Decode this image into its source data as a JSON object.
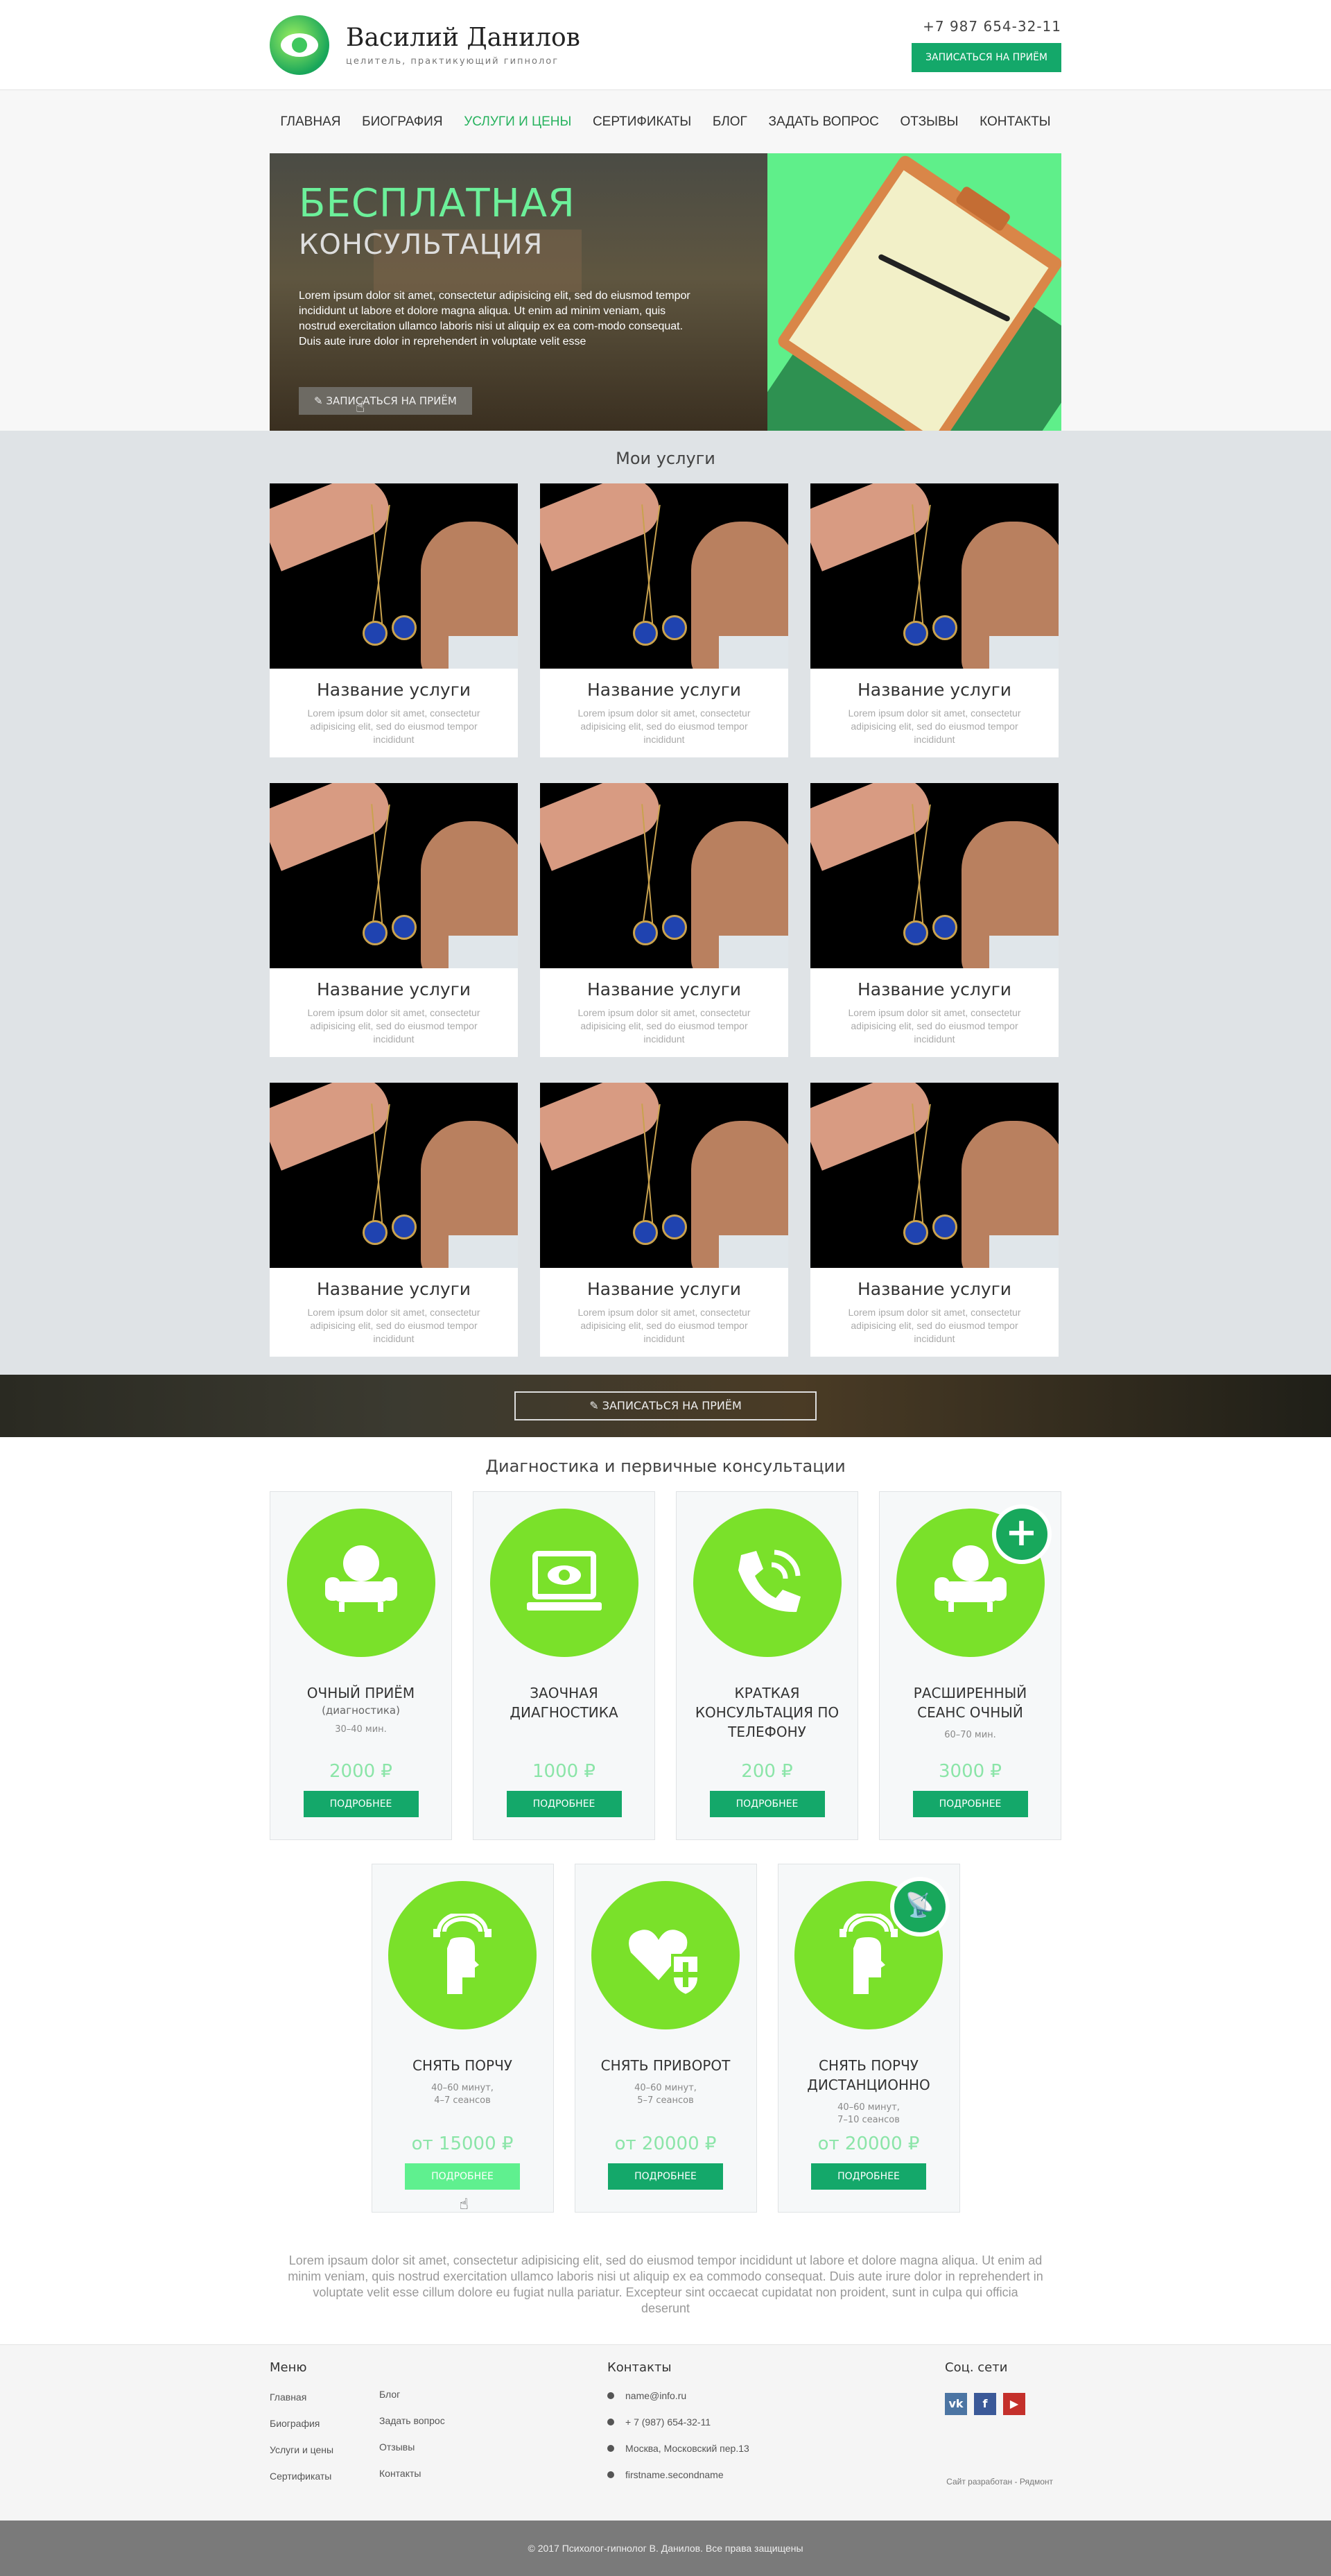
{
  "header": {
    "name": "Василий Данилов",
    "tagline": "целитель, практикующий гипнолог",
    "phone": "+7 987 654-32-11",
    "cta": "Записаться на приём"
  },
  "nav": [
    "Главная",
    "Биография",
    "Услуги и цены",
    "Сертификаты",
    "Блог",
    "Задать вопрос",
    "Отзывы",
    "Контакты"
  ],
  "nav_active": "Услуги и цены",
  "hero": {
    "title1": "БЕСПЛАТНАЯ",
    "title2": "КОНСУЛЬТАЦИЯ",
    "text": "Lorem ipsum dolor sit amet, consectetur adipisicing elit, sed do eiusmod tempor incididunt ut labore et dolore magna aliqua. Ut enim ad minim veniam, quis nostrud exercitation ullamco laboris nisi ut aliquip ex ea com-modo consequat. Duis aute irure dolor in reprehendert in voluptate velit esse",
    "button": "Записаться на приём"
  },
  "services": {
    "title": "Мои услуги",
    "items": [
      {
        "name": "Название услуги",
        "desc": "Lorem ipsum dolor sit amet, consectetur adipisicing elit, sed do eiusmod tempor incididunt"
      },
      {
        "name": "Название услуги",
        "desc": "Lorem ipsum dolor sit amet, consectetur adipisicing elit, sed do eiusmod tempor incididunt"
      },
      {
        "name": "Название услуги",
        "desc": "Lorem ipsum dolor sit amet, consectetur adipisicing elit, sed do eiusmod tempor incididunt"
      },
      {
        "name": "Название услуги",
        "desc": "Lorem ipsum dolor sit amet, consectetur adipisicing elit, sed do eiusmod tempor incididunt"
      },
      {
        "name": "Название услуги",
        "desc": "Lorem ipsum dolor sit amet, consectetur adipisicing elit, sed do eiusmod tempor incididunt"
      },
      {
        "name": "Название услуги",
        "desc": "Lorem ipsum dolor sit amet, consectetur adipisicing elit, sed do eiusmod tempor incididunt"
      },
      {
        "name": "Название услуги",
        "desc": "Lorem ipsum dolor sit amet, consectetur adipisicing elit, sed do eiusmod tempor incididunt"
      },
      {
        "name": "Название услуги",
        "desc": "Lorem ipsum dolor sit amet, consectetur adipisicing elit, sed do eiusmod tempor incididunt"
      },
      {
        "name": "Название услуги",
        "desc": "Lorem ipsum dolor sit amet, consectetur adipisicing elit, sed do eiusmod tempor incididunt"
      }
    ]
  },
  "cta_band": {
    "button": "Записаться на приём"
  },
  "diagnostics": {
    "title": "Диагностика и первичные консультации",
    "row1": [
      {
        "title": "Очный приём",
        "sub": "(диагностика)",
        "time": "30–40 мин.",
        "price": "2000 ₽",
        "button": "Подробнее",
        "icon": "armchair-icon"
      },
      {
        "title": "Заочная диагностика",
        "sub": "",
        "time": "",
        "price": "1000 ₽",
        "button": "Подробнее",
        "icon": "laptop-eye-icon"
      },
      {
        "title": "Краткая консультация по телефону",
        "sub": "",
        "time": "",
        "price": "200 ₽",
        "button": "Подробнее",
        "icon": "phone-icon"
      },
      {
        "title": "Расширенный сеанс очный",
        "sub": "",
        "time": "60–70 мин.",
        "price": "3000 ₽",
        "button": "Подробнее",
        "icon": "armchair-plus-icon",
        "badge": "+"
      }
    ],
    "row2": [
      {
        "title": "Снять порчу",
        "time": "40–60 минут,",
        "time2": "4–7 сеансов",
        "price": "от 15000 ₽",
        "button": "Подробнее",
        "icon": "head-rainbow-icon"
      },
      {
        "title": "Снять приворот",
        "time": "40–60 минут,",
        "time2": "5–7 сеансов",
        "price": "от 20000 ₽",
        "button": "Подробнее",
        "icon": "heart-shield-icon"
      },
      {
        "title": "Снять порчу дистанционно",
        "time": "40–60 минут,",
        "time2": "7–10 сеансов",
        "price": "от 20000 ₽",
        "button": "Подробнее",
        "icon": "head-satellite-icon"
      }
    ]
  },
  "lorem": "Lorem ipsaum dolor sit amet, consectetur adipisicing elit, sed do eiusmod tempor incididunt ut labore et dolore magna aliqua. Ut enim ad minim veniam, quis nostrud exercitation ullamco laboris nisi ut aliquip ex ea commodo consequat. Duis aute irure dolor in reprehendert in voluptate velit esse cillum dolore eu fugiat nulla pariatur. Excepteur sint occaecat cupidatat non proident, sunt in culpa qui officia deserunt",
  "footer": {
    "menu_title": "Меню",
    "menu_col1": [
      "Главная",
      "Биография",
      "Услуги и цены",
      "Сертификаты"
    ],
    "menu_col2": [
      "Блог",
      "Задать вопрос",
      "Отзывы",
      "Контакты"
    ],
    "contacts_title": "Контакты",
    "email": "name@info.ru",
    "phone": "+ 7 (987) 654-32-11",
    "address": "Москва, Московский  пер.13",
    "skype": "firstname.secondname",
    "social_title": "Соц. сети",
    "developer": "Сайт разработан - Рядмонт",
    "copyright": "© 2017 Психолог-гипнолог В. Данилов. Все права защищены"
  },
  "colors": {
    "accent": "#14a86a",
    "icon_bg": "#7ae12a",
    "hero_green": "#5fef8a"
  }
}
